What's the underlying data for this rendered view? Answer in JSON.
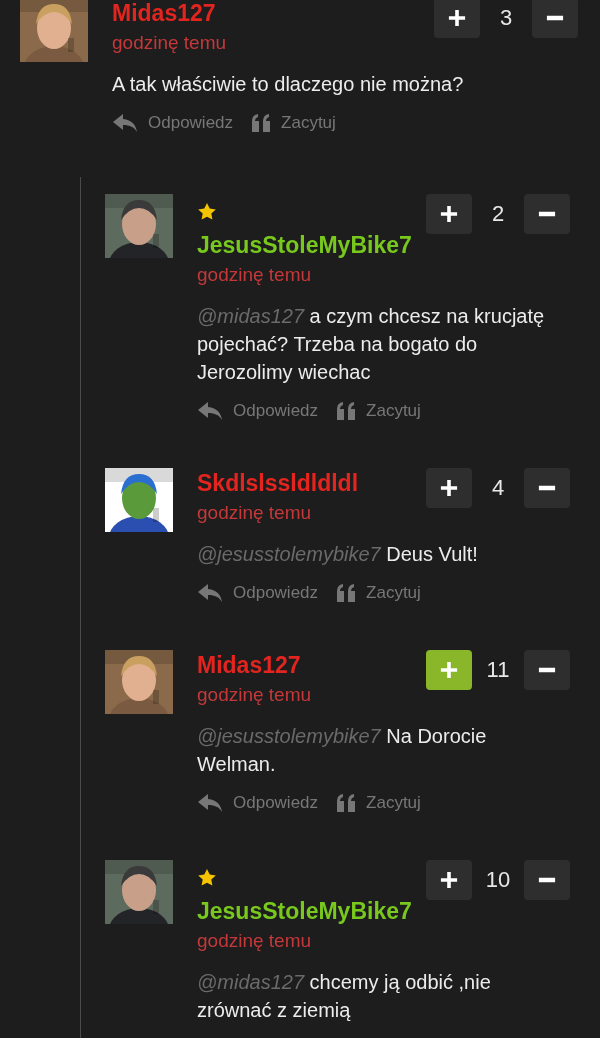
{
  "comments": [
    {
      "author": "Midas127",
      "color": "#e3241f",
      "starred": false,
      "time": "godzinę temu",
      "text": "A tak właściwie to dlaczego nie można?",
      "score": "3",
      "upvoted": false,
      "actions": [
        "Odpowiedz",
        "Zacytuj"
      ],
      "replies": [
        {
          "author": "JesusStoleMyBike7",
          "color": "#78c81e",
          "starred": true,
          "time": "godzinę temu",
          "mention": "@midas127",
          "text": "a czym chcesz na krucjatę pojechać? Trzeba na bogato do Jerozolimy wiechac",
          "score": "2",
          "upvoted": false,
          "actions": [
            "Odpowiedz",
            "Zacytuj"
          ]
        },
        {
          "author": "Skdlslssldldldl",
          "color": "#e3241f",
          "starred": false,
          "time": "godzinę temu",
          "mention": "@jesusstolemybike7",
          "text": "Deus Vult!",
          "score": "4",
          "upvoted": false,
          "actions": [
            "Odpowiedz",
            "Zacytuj"
          ]
        },
        {
          "author": "Midas127",
          "color": "#e3241f",
          "starred": false,
          "time": "godzinę temu",
          "mention": "@jesusstolemybike7",
          "text": "Na Dorocie Welman.",
          "score": "11",
          "upvoted": true,
          "actions": [
            "Odpowiedz",
            "Zacytuj"
          ]
        },
        {
          "author": "JesusStoleMyBike7",
          "color": "#78c81e",
          "starred": true,
          "time": "godzinę temu",
          "mention": "@midas127",
          "text": "chcemy ją odbić ,nie zrównać z ziemią",
          "score": "10",
          "upvoted": false
        }
      ]
    }
  ]
}
